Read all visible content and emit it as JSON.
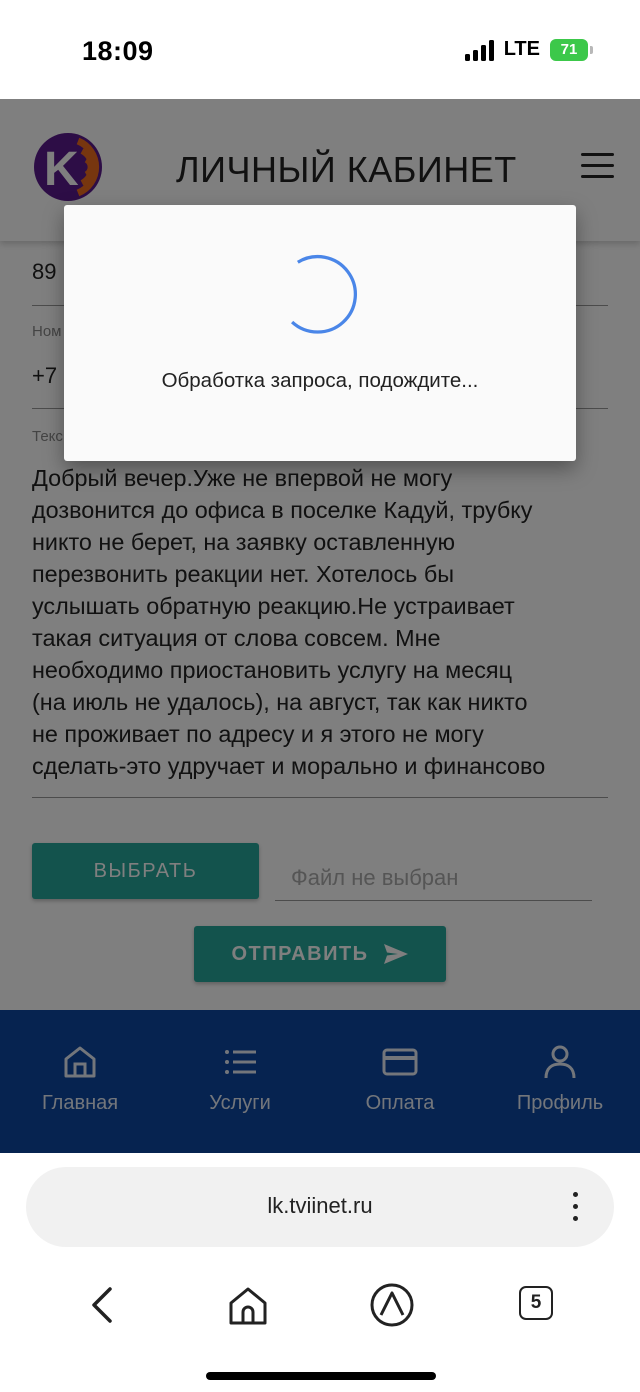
{
  "status_bar": {
    "time": "18:09",
    "network": "LTE",
    "battery": "71"
  },
  "header": {
    "title": "ЛИЧНЫЙ КАБИНЕТ",
    "logo_letter": "K",
    "logo_icon": "company-logo-icon",
    "menu_icon": "hamburger-menu-icon"
  },
  "form": {
    "phone_value": "89",
    "contact_label": "Ном",
    "contact_value": "+7",
    "message_label": "Текс",
    "message_text": "Добрый вечер.Уже не впервой не могу\nдозвонится до офиса в поселке Кадуй, трубку\nникто не берет, на заявку оставленную\nперезвонить реакции нет. Хотелось бы\nуслышать обратную реакцию.Не устраивает\nтакая ситуация от слова совсем. Мне\nнеобходимо  приостановить услугу на месяц\n(на июль не удалось), на август, так как никто\nне проживает по адресу и я этого не могу\nсделать-это удручает и морально и финансово",
    "choose_label": "ВЫБРАТЬ",
    "file_placeholder": "Файл не выбран",
    "send_label": "ОТПРАВИТЬ",
    "send_icon": "send-arrow-icon"
  },
  "bottom_nav": [
    {
      "label": "Главная",
      "icon": "home-icon"
    },
    {
      "label": "Услуги",
      "icon": "list-icon"
    },
    {
      "label": "Оплата",
      "icon": "credit-card-icon"
    },
    {
      "label": "Профиль",
      "icon": "person-icon"
    }
  ],
  "dialog": {
    "message": "Обработка запроса, подождите..."
  },
  "browser": {
    "url": "lk.tviinet.ru",
    "tab_count": "5"
  },
  "colors": {
    "accent": "#26a69a",
    "nav_bg": "#0d47a1",
    "spinner": "#4a86e8",
    "logo_purple": "#5b1a8c",
    "logo_orange": "#ef6c1f"
  }
}
